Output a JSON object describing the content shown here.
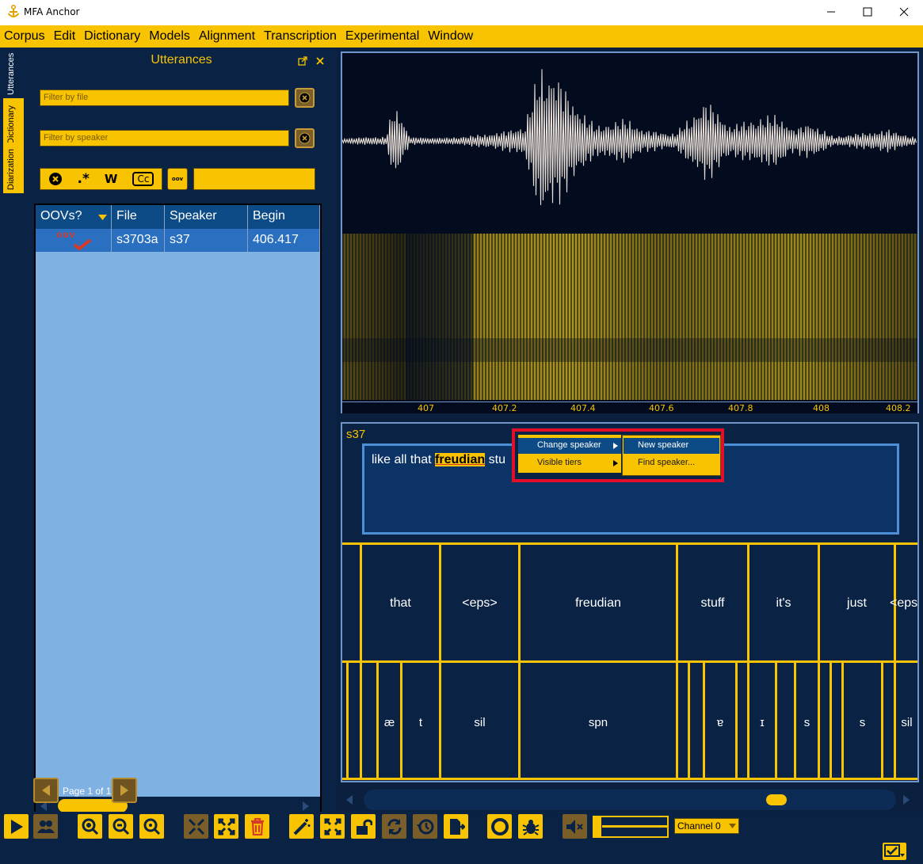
{
  "window": {
    "title": "MFA Anchor"
  },
  "menu": [
    "Corpus",
    "Edit",
    "Dictionary",
    "Models",
    "Alignment",
    "Transcription",
    "Experimental",
    "Window"
  ],
  "side_tabs": [
    "Utterances",
    "Dictionary",
    "Diarization"
  ],
  "utterances_panel": {
    "title": "Utterances",
    "file_filter_placeholder": "Filter by file",
    "speaker_filter_placeholder": "Filter by speaker",
    "search_tools": {
      "regex": ".*",
      "word": "W",
      "case": "Cc"
    },
    "oov_label": "oov",
    "columns": [
      "OOVs?",
      "File",
      "Speaker",
      "Begin"
    ],
    "rows": [
      {
        "oov": "oov",
        "file": "s3703a",
        "speaker": "s37",
        "begin": "406.417"
      }
    ],
    "page_label": "Page 1 of 1"
  },
  "waveform": {
    "time_ticks": [
      "407",
      "407.2",
      "407.4",
      "407.6",
      "407.8",
      "408",
      "408.2"
    ]
  },
  "transcript": {
    "speaker": "s37",
    "text_before": "like all that ",
    "highlight": "freudian",
    "text_after": " stu",
    "word_tier": [
      "that",
      "<eps>",
      "freudian",
      "stuff",
      "it's",
      "just",
      "<eps"
    ],
    "phone_tier": [
      "æ",
      "t",
      "sil",
      "spn",
      "ɐ",
      "ɪ",
      "s",
      "s",
      "sil"
    ]
  },
  "context_menu": {
    "items": [
      "Change speaker",
      "Visible tiers"
    ],
    "submenu": [
      "New speaker",
      "Find speaker..."
    ]
  },
  "toolbar": {
    "channel": "Channel 0"
  },
  "colors": {
    "accent": "#f8c300",
    "background": "#0a2244",
    "selection": "#2a6fc0",
    "highlight_box": "#e0102a"
  }
}
